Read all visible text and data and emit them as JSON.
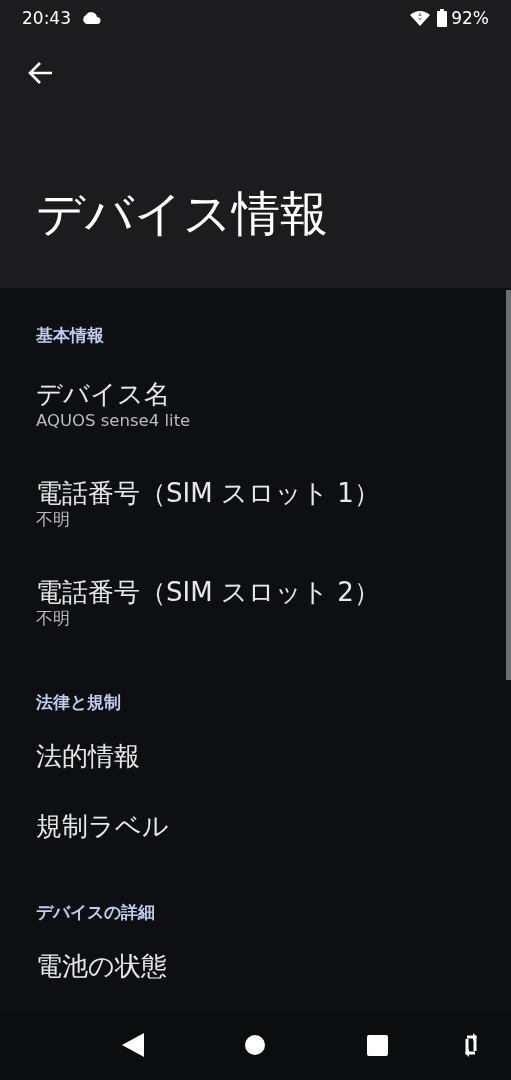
{
  "status_bar": {
    "time": "20:43",
    "battery": "92%"
  },
  "app_bar": {
    "title": "デバイス情報"
  },
  "sections": [
    {
      "header": "基本情報",
      "items": [
        {
          "title": "デバイス名",
          "summary": "AQUOS sense4 lite"
        },
        {
          "title": "電話番号（SIM スロット 1）",
          "summary": "不明"
        },
        {
          "title": "電話番号（SIM スロット 2）",
          "summary": "不明"
        }
      ]
    },
    {
      "header": "法律と規制",
      "items": [
        {
          "title": "法的情報"
        },
        {
          "title": "規制ラベル"
        }
      ]
    },
    {
      "header": "デバイスの詳細",
      "items": [
        {
          "title": "電池の状態"
        }
      ]
    }
  ]
}
